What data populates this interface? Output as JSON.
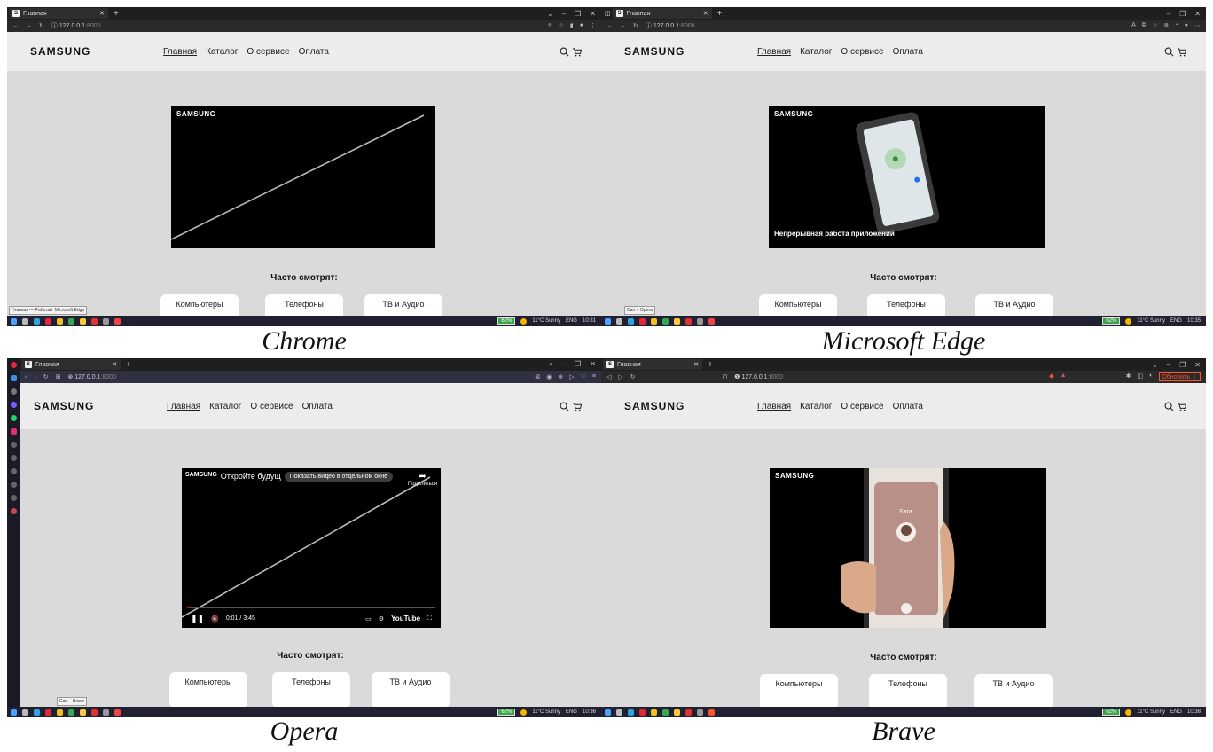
{
  "site": {
    "logo": "SAMSUNG",
    "nav": [
      "Главная",
      "Каталог",
      "О сервисе",
      "Оплата"
    ],
    "video_logo": "SAMSUNG",
    "often_title": "Часто смотрят:",
    "cards": [
      "Компьютеры",
      "Телефоны",
      "ТВ и Аудио"
    ]
  },
  "browser": {
    "tab_title": "Главная",
    "url_host": "127.0.0.1",
    "url_port": ":8000",
    "favicon": "S",
    "weather": "11°C Sunny",
    "lang": "ENG",
    "battery": "62%"
  },
  "panels": {
    "chrome": {
      "caption": "Chrome",
      "clock": "10:31",
      "taskbar_hint": "Главная — Работай: Microsoft Edge"
    },
    "edge": {
      "caption": "Microsoft Edge",
      "clock": "10:35",
      "taskbar_hint": "Cart – Opera",
      "video_caption": "Непрерывная работа приложений"
    },
    "opera": {
      "caption": "Opera",
      "clock": "10:36",
      "taskbar_hint": "Cart – Brave",
      "yt_title": "Откройте будущ",
      "yt_pip": "Показать видео в отдельном окне",
      "yt_share": "Поделиться",
      "yt_time": "0:01 / 3:45",
      "yt_brand": "YouTube",
      "yt_progress": 0.01
    },
    "brave": {
      "caption": "Brave",
      "clock": "10:38",
      "update_btn": "Обновить",
      "phone_contact": "Sara"
    }
  },
  "colors": {
    "page_bg": "#dadada",
    "header_bg": "#ececec",
    "video_bg": "#000000",
    "taskbar_bg": "#202030"
  }
}
